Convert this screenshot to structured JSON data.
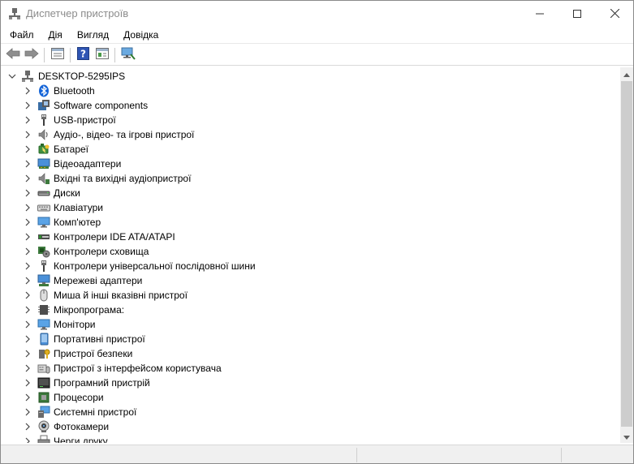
{
  "window": {
    "title": "Диспетчер пристроїв"
  },
  "menu": {
    "items": [
      "Файл",
      "Дія",
      "Вигляд",
      "Довідка"
    ]
  },
  "toolbar": {
    "icons": [
      "back-arrow-icon",
      "forward-arrow-icon",
      "properties-icon",
      "help-icon",
      "update-driver-icon",
      "scan-hardware-icon"
    ]
  },
  "tree": {
    "root": "DESKTOP-5295IPS",
    "items": [
      {
        "label": "Bluetooth",
        "icon": "bluetooth-icon"
      },
      {
        "label": "Software components",
        "icon": "software-components-icon"
      },
      {
        "label": "USB-пристрої",
        "icon": "usb-icon"
      },
      {
        "label": "Аудіо-, відео- та ігрові пристрої",
        "icon": "speaker-icon"
      },
      {
        "label": "Батареї",
        "icon": "battery-icon"
      },
      {
        "label": "Відеоадаптери",
        "icon": "display-adapter-icon"
      },
      {
        "label": "Вхідні та вихідні аудіопристрої",
        "icon": "audio-io-icon"
      },
      {
        "label": "Диски",
        "icon": "disk-icon"
      },
      {
        "label": "Клавіатури",
        "icon": "keyboard-icon"
      },
      {
        "label": "Комп'ютер",
        "icon": "computer-icon"
      },
      {
        "label": "Контролери IDE ATA/ATAPI",
        "icon": "ide-controller-icon"
      },
      {
        "label": "Контролери сховища",
        "icon": "storage-controller-icon"
      },
      {
        "label": "Контролери універсальної послідовної шини",
        "icon": "usb-controller-icon"
      },
      {
        "label": "Мережеві адаптери",
        "icon": "network-adapter-icon"
      },
      {
        "label": "Миша й інші вказівні пристрої",
        "icon": "mouse-icon"
      },
      {
        "label": "Мікропрограма:",
        "icon": "firmware-icon"
      },
      {
        "label": "Монітори",
        "icon": "monitor-icon"
      },
      {
        "label": "Портативні пристрої",
        "icon": "portable-device-icon"
      },
      {
        "label": "Пристрої безпеки",
        "icon": "security-device-icon"
      },
      {
        "label": "Пристрої з інтерфейсом користувача",
        "icon": "hid-icon"
      },
      {
        "label": "Програмний пристрій",
        "icon": "software-device-icon"
      },
      {
        "label": "Процесори",
        "icon": "processor-icon"
      },
      {
        "label": "Системні пристрої",
        "icon": "system-device-icon"
      },
      {
        "label": "Фотокамери",
        "icon": "camera-icon"
      },
      {
        "label": "Черги друку",
        "icon": "print-queue-icon"
      }
    ]
  }
}
